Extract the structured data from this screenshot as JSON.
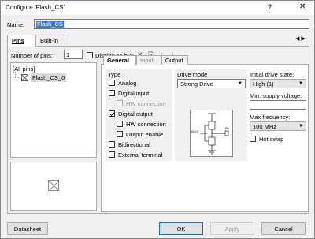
{
  "window": {
    "title": "Configure 'Flash_CS'",
    "help": "?",
    "close": "✕"
  },
  "name": {
    "label": "Name:",
    "value": "Flash_CS"
  },
  "tabs": [
    {
      "label": "Pins"
    },
    {
      "label": "Built-in"
    }
  ],
  "tab_arrows": "◀ ▶",
  "pins_panel": {
    "num_pins_label": "Number of pins:",
    "num_pins_value": "1",
    "display_as_bus_label": "Display as bus",
    "tree_root": "[All pins]",
    "tree_item": "Flash_CS_0"
  },
  "toolbar": {
    "delete_icon": "✕",
    "rename_icon": "⎘",
    "up_icon": "↑",
    "down_icon": "↓"
  },
  "inner_tabs": [
    {
      "label": "General"
    },
    {
      "label": "Input"
    },
    {
      "label": "Output"
    }
  ],
  "type_group": {
    "label": "Type",
    "analog": "Analog",
    "digital_input": "Digital input",
    "hw_connection_in": "HW connection",
    "digital_output": "Digital output",
    "hw_connection_out": "HW connection",
    "output_enable": "Output enable",
    "bidirectional": "Bidirectional",
    "external_terminal": "External terminal"
  },
  "drive_mode": {
    "label": "Drive mode",
    "value": "Strong Drive",
    "circuit_in": "DOUT",
    "circuit_pin": "Pin"
  },
  "right_group": {
    "initial_drive_label": "Initial drive state:",
    "initial_drive_value": "High (1)",
    "min_supply_label": "Min. supply voltage:",
    "min_supply_value": "",
    "max_freq_label": "Max frequency:",
    "max_freq_value": "100 MHz",
    "hot_swap": "Hot swap"
  },
  "footer": {
    "datasheet": "Datasheet",
    "ok": "OK",
    "apply": "Apply",
    "cancel": "Cancel"
  }
}
